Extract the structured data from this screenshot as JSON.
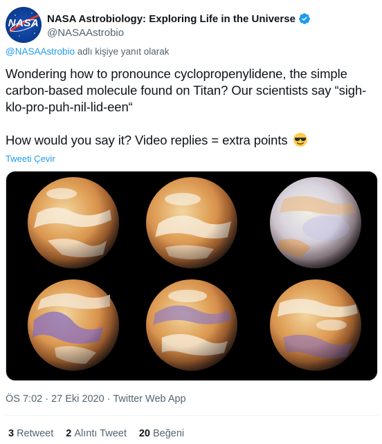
{
  "author": {
    "display_name": "NASA Astrobiology: Exploring Life in the Universe",
    "handle": "@NASAAstrobio",
    "avatar_text": "NASA",
    "verified": true
  },
  "reply_context": {
    "mention": "@NASAAstrobio",
    "suffix": " adlı kişiye yanıt olarak"
  },
  "tweet": {
    "paragraph_1": "Wondering how to pronounce cyclopropenylidene, the simple carbon-based molecule found on Titan? Our scientists say “sigh-klo-pro-puh-nil-lid-een“",
    "paragraph_2": "How would you say it? Video replies = extra points",
    "emoji": "smiling-face-with-sunglasses-icon"
  },
  "translate_label": "Tweeti Çevir",
  "media": {
    "description_icon": "titan-moon-images",
    "globe_count": 6
  },
  "meta": {
    "time": "ÖS 7:02",
    "separator": " · ",
    "date": "27 Eki 2020",
    "source": "Twitter Web App"
  },
  "stats": [
    {
      "count": "3",
      "label": "Retweet"
    },
    {
      "count": "2",
      "label": "Alıntı Tweet"
    },
    {
      "count": "20",
      "label": "Beğeni"
    }
  ],
  "colors": {
    "link": "#1d9bf0",
    "secondary_text": "#536471",
    "primary_text": "#0f1419",
    "verified_badge": "#1d9bf0"
  }
}
